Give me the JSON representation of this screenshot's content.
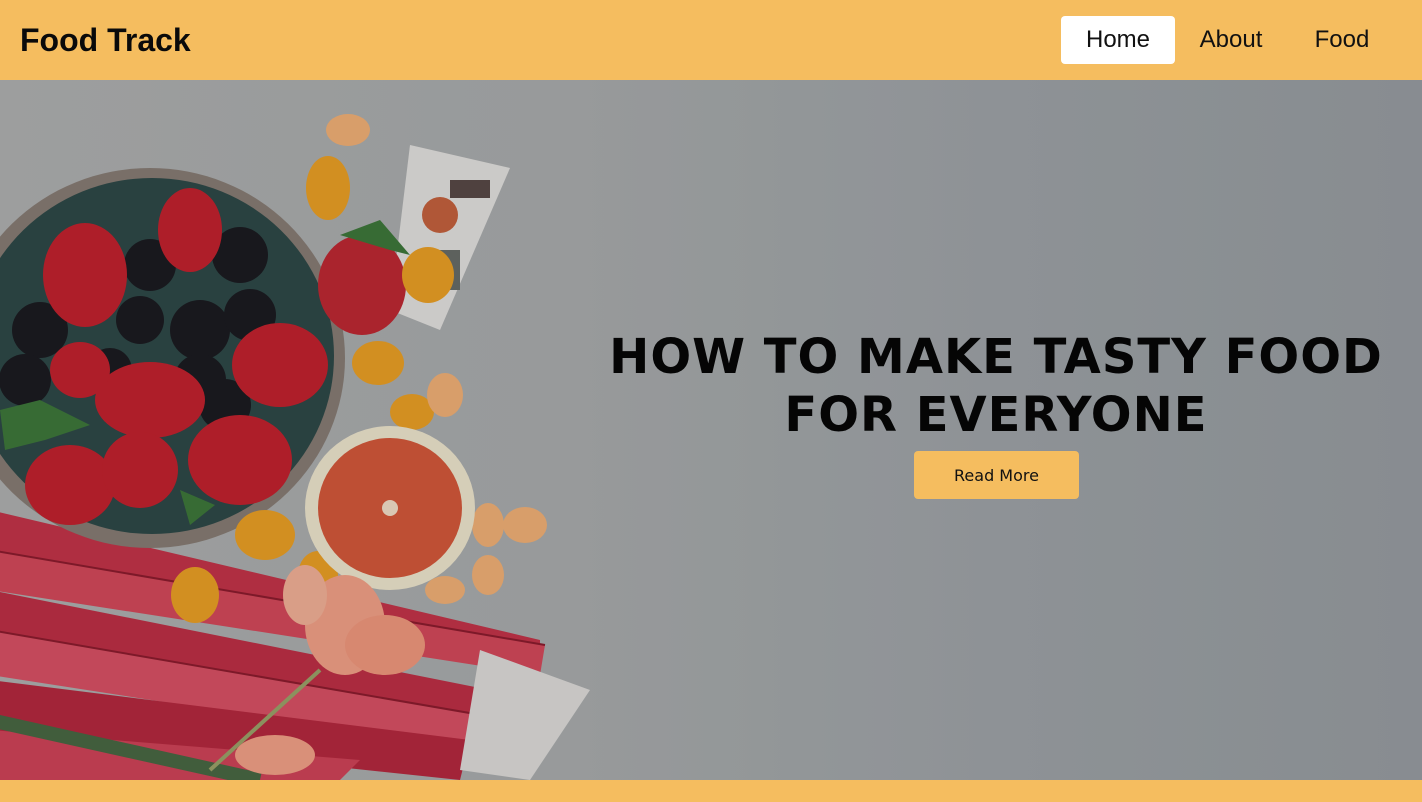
{
  "brand": {
    "title": "Food Track"
  },
  "nav": {
    "items": [
      {
        "label": "Home",
        "active": true
      },
      {
        "label": "About",
        "active": false
      },
      {
        "label": "Food",
        "active": false
      }
    ]
  },
  "hero": {
    "title_line1": "HOW TO MAKE TASTY FOOD",
    "title_line2": "FOR EVERYONE",
    "button_label": "Read More"
  },
  "colors": {
    "accent": "#f5bd5f",
    "active_nav_bg": "#ffffff",
    "hero_background": "#a8abad",
    "text": "#050505"
  }
}
